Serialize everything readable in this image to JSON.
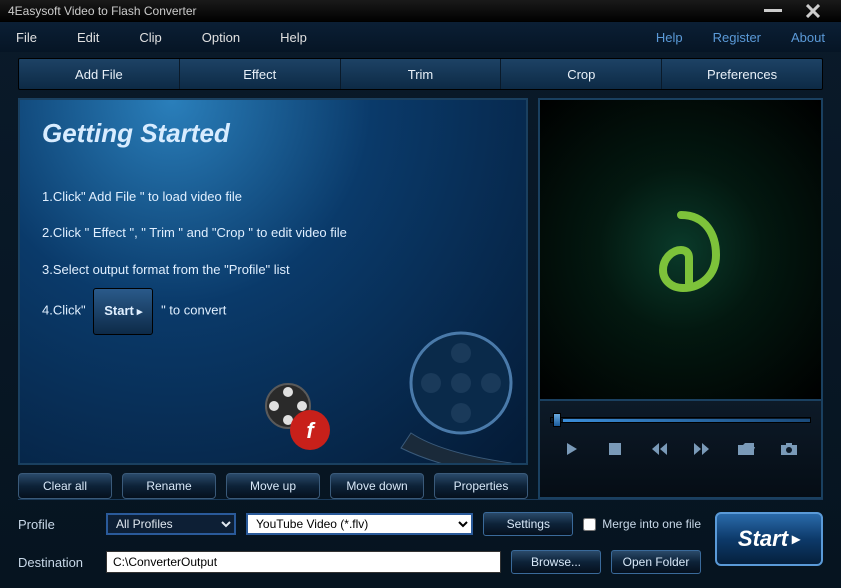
{
  "title": "4Easysoft Video to Flash Converter",
  "menu": {
    "items": [
      "File",
      "Edit",
      "Clip",
      "Option",
      "Help"
    ]
  },
  "menu_right": {
    "items": [
      "Help",
      "Register",
      "About"
    ]
  },
  "toolbar": {
    "items": [
      "Add File",
      "Effect",
      "Trim",
      "Crop",
      "Preferences"
    ]
  },
  "welcome": {
    "title": "Getting Started",
    "steps": [
      "1.Click\" Add File \" to load video file",
      "2.Click \" Effect \", \" Trim \" and \"Crop \" to edit video file",
      "3.Select output format from the \"Profile\" list",
      "4.Click\""
    ],
    "step4_suffix": "\" to convert",
    "inline_btn": "Start"
  },
  "list_buttons": [
    "Clear all",
    "Rename",
    "Move up",
    "Move down",
    "Properties"
  ],
  "profile": {
    "label": "Profile",
    "category": "All Profiles",
    "format": "YouTube Video (*.flv)",
    "settings_btn": "Settings",
    "merge_label": "Merge into one file",
    "merge_checked": false
  },
  "destination": {
    "label": "Destination",
    "value": "C:\\ConverterOutput",
    "browse_btn": "Browse...",
    "open_btn": "Open Folder"
  },
  "start_btn": "Start",
  "colors": {
    "accent": "#2a6aaa",
    "panel_border": "#1a4060",
    "logo": "#7dc23a"
  }
}
